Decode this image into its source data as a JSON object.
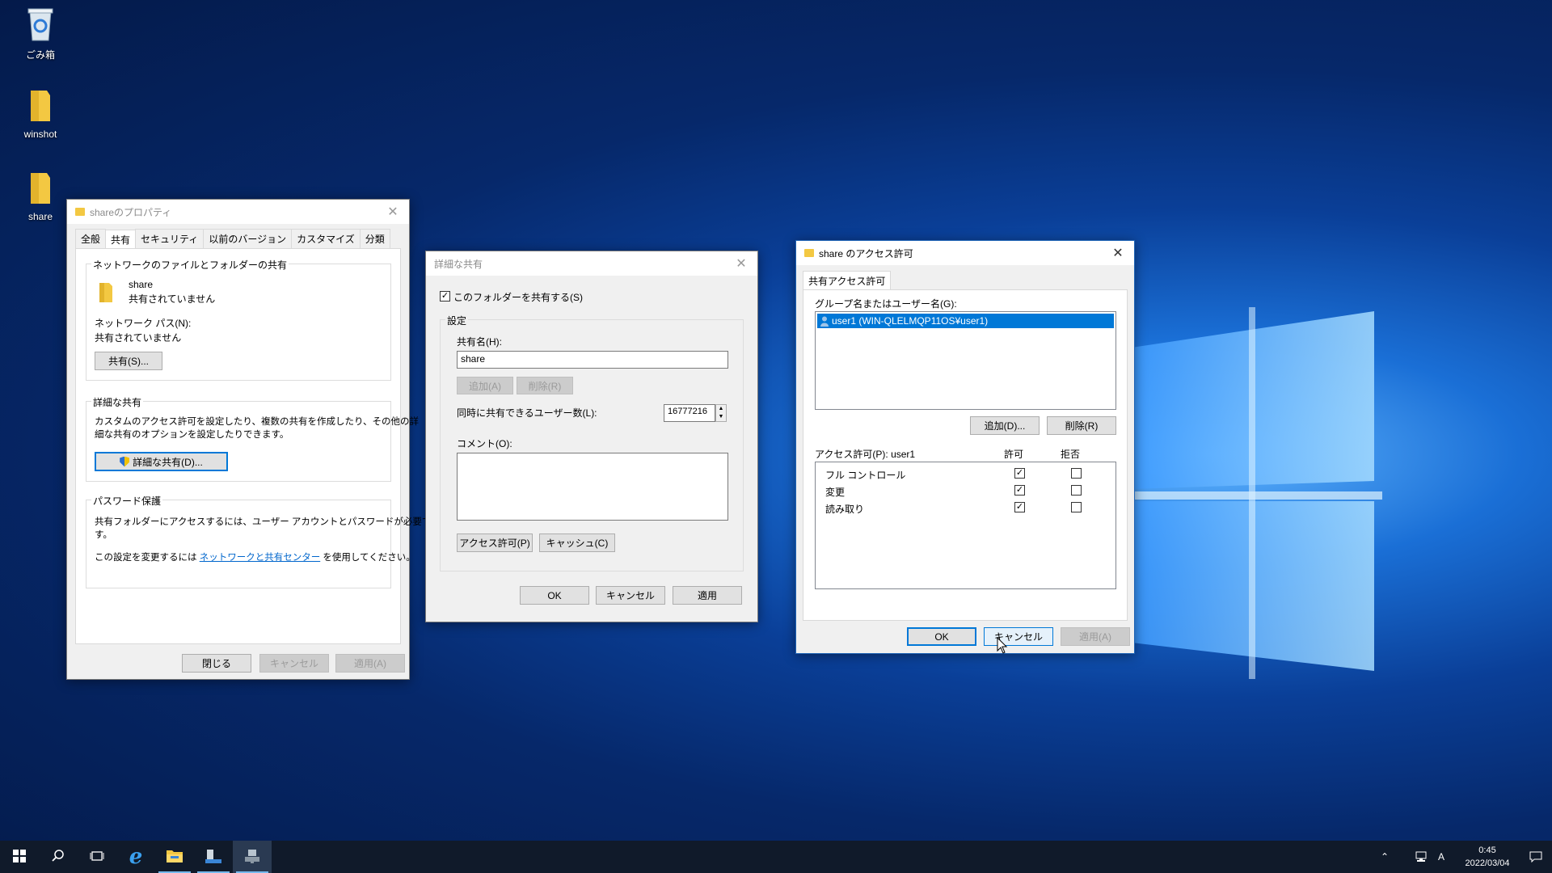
{
  "desktop": {
    "icons": [
      {
        "label": "ごみ箱",
        "icon": "recycle-bin-icon"
      },
      {
        "label": "winshot",
        "icon": "folder-icon"
      },
      {
        "label": "share",
        "icon": "folder-icon"
      }
    ]
  },
  "properties_dialog": {
    "title": "shareのプロパティ",
    "tabs": [
      "全般",
      "共有",
      "セキュリティ",
      "以前のバージョン",
      "カスタマイズ",
      "分類"
    ],
    "active_tab": "共有",
    "network_group": {
      "label": "ネットワークのファイルとフォルダーの共有",
      "folder_name": "share",
      "folder_status": "共有されていません",
      "path_label": "ネットワーク パス(N):",
      "path_value": "共有されていません",
      "share_button": "共有(S)..."
    },
    "advanced_group": {
      "label": "詳細な共有",
      "description_line1": "カスタムのアクセス許可を設定したり、複数の共有を作成したり、その他の詳",
      "description_line2": "細な共有のオプションを設定したりできます。",
      "button": "詳細な共有(D)..."
    },
    "password_group": {
      "label": "パスワード保護",
      "line1": "共有フォルダーにアクセスするには、ユーザー アカウントとパスワードが必要で",
      "line2": "す。",
      "change_prefix": "この設定を変更するには",
      "change_link": "ネットワークと共有センター",
      "change_suffix": "を使用してください。"
    },
    "buttons": {
      "close": "閉じる",
      "cancel": "キャンセル",
      "apply": "適用(A)"
    }
  },
  "advanced_dialog": {
    "title": "詳細な共有",
    "share_checkbox_label": "このフォルダーを共有する(S)",
    "share_checked": true,
    "settings_group_label": "設定",
    "share_name_label": "共有名(H):",
    "share_name_value": "share",
    "add_button": "追加(A)",
    "remove_button": "削除(R)",
    "user_limit_label": "同時に共有できるユーザー数(L):",
    "user_limit_value": "16777216",
    "comment_label": "コメント(O):",
    "comment_value": "",
    "permissions_button": "アクセス許可(P)",
    "caching_button": "キャッシュ(C)",
    "buttons": {
      "ok": "OK",
      "cancel": "キャンセル",
      "apply": "適用"
    }
  },
  "permissions_dialog": {
    "title": "share のアクセス許可",
    "tab": "共有アクセス許可",
    "group_label": "グループ名またはユーザー名(G):",
    "users": [
      "user1 (WIN-QLELMQP11OS¥user1)"
    ],
    "add_button": "追加(D)...",
    "remove_button": "削除(R)",
    "perm_label": "アクセス許可(P): user1",
    "allow_header": "許可",
    "deny_header": "拒否",
    "permissions": [
      {
        "name": "フル コントロール",
        "allow": true,
        "deny": false
      },
      {
        "name": "変更",
        "allow": true,
        "deny": false
      },
      {
        "name": "読み取り",
        "allow": true,
        "deny": false
      }
    ],
    "buttons": {
      "ok": "OK",
      "cancel": "キャンセル",
      "apply": "適用(A)"
    }
  },
  "taskbar": {
    "items": [
      "start-icon",
      "search-icon",
      "task-view-icon",
      "internet-explorer-icon",
      "file-explorer-icon",
      "server-manager-icon",
      "network-app-icon"
    ],
    "tray": {
      "time": "0:45",
      "date": "2022/03/04",
      "ime": "A"
    }
  },
  "colors": {
    "selection": "#0078d7",
    "link": "#0066cc",
    "folder": "#f3c842",
    "taskbar": "#101a2a"
  }
}
